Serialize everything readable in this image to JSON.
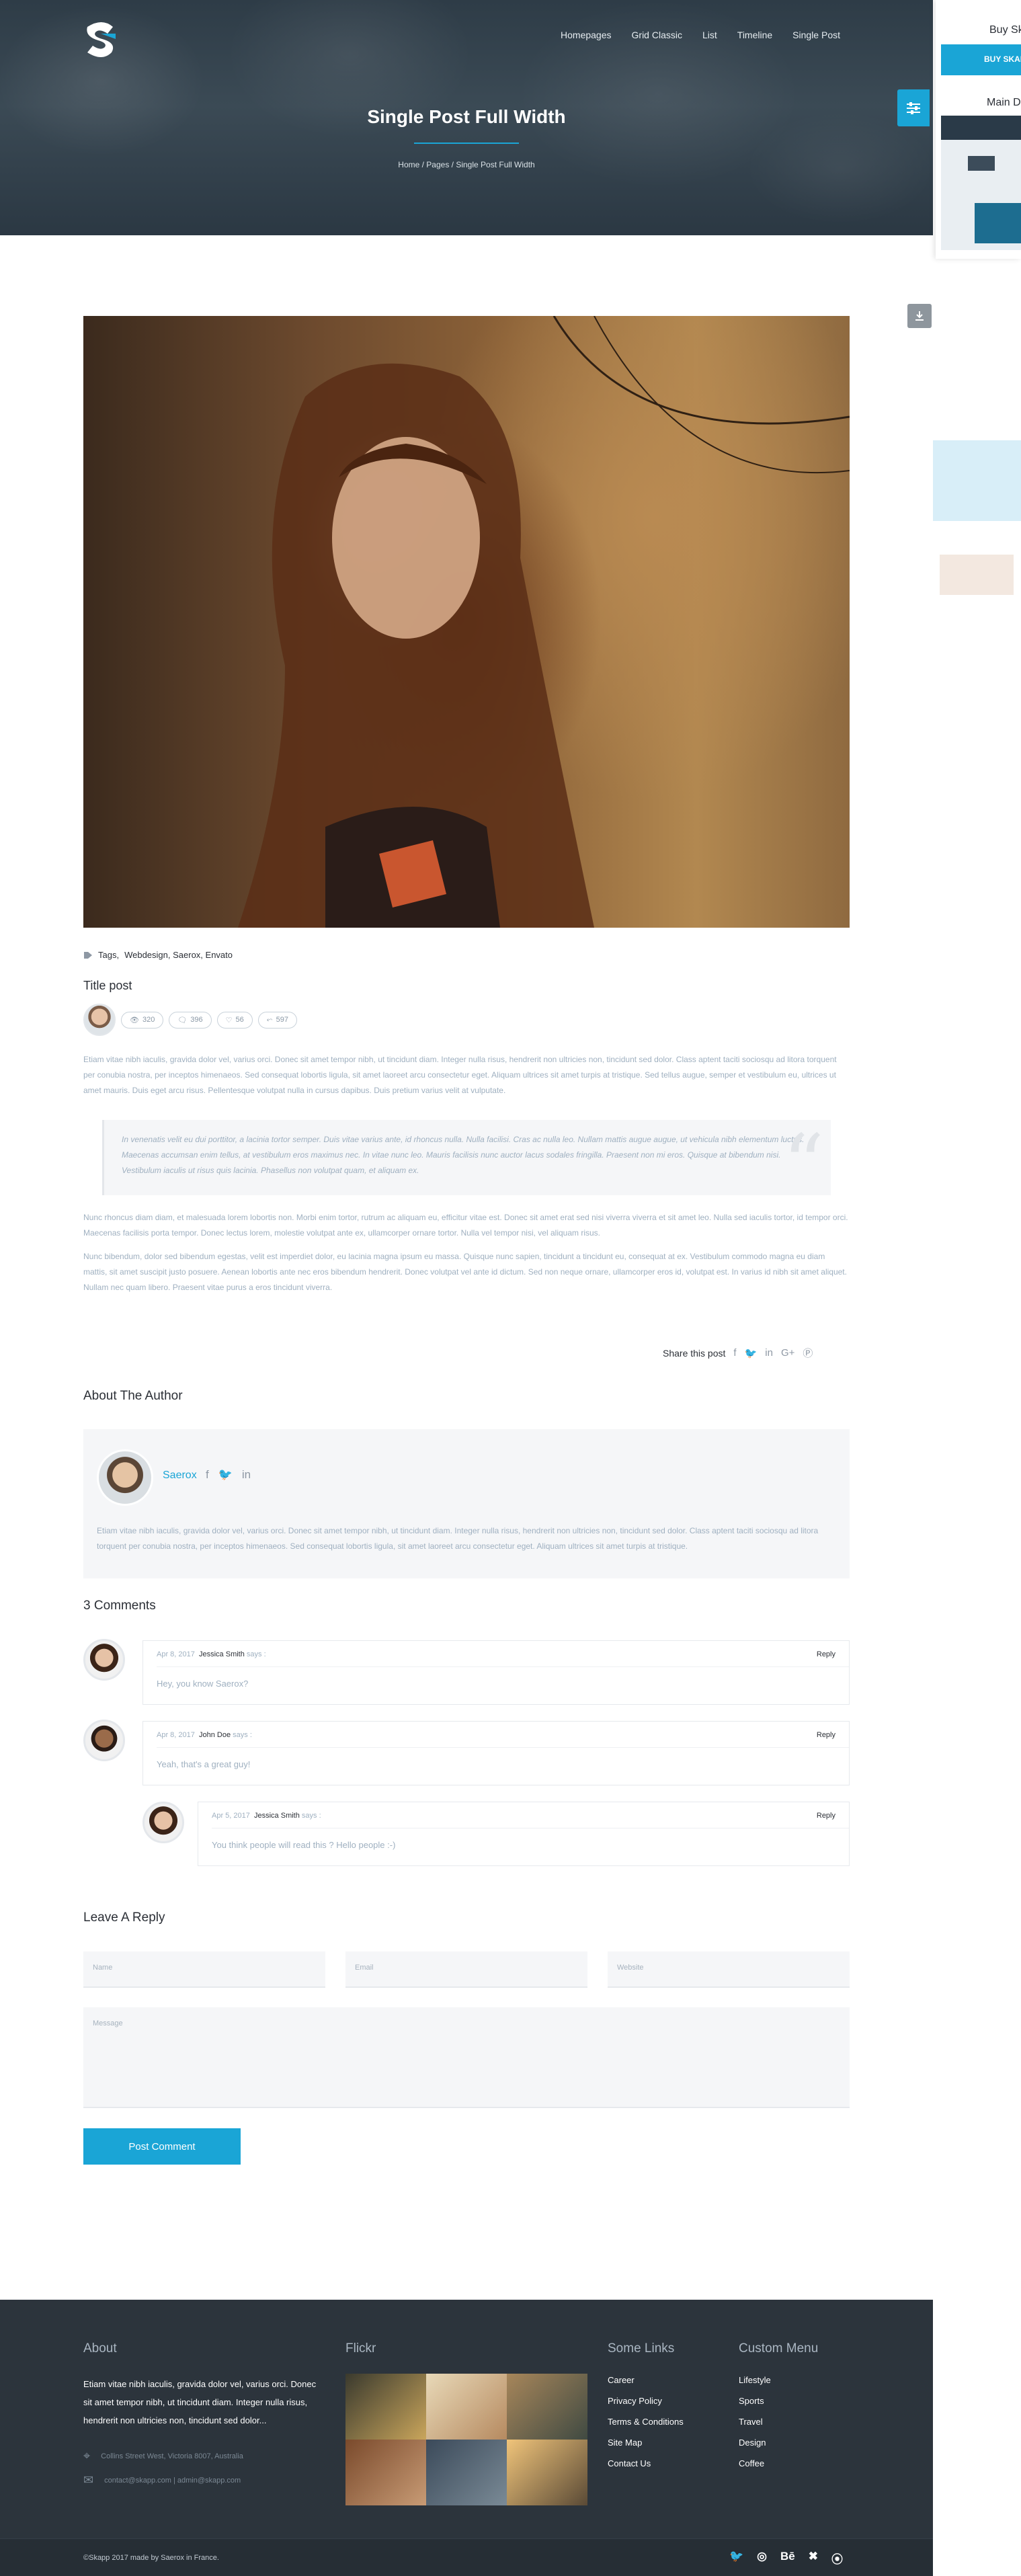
{
  "header": {
    "nav": [
      "Homepages",
      "Grid Classic",
      "List",
      "Timeline",
      "Single Post"
    ],
    "title": "Single Post Full Width",
    "breadcrumb": "Home  /  Pages  /  Single Post Full Width"
  },
  "side_panel": {
    "buy_title": "Buy Sk",
    "buy_button": "BUY SKAP",
    "main_demo": "Main D"
  },
  "post": {
    "tags_label": "Tags,",
    "tags": "Webdesign,  Saerox,  Envato",
    "title": "Title post",
    "stats": {
      "views": "320",
      "comments": "396",
      "likes": "56",
      "shares": "597"
    },
    "p1": "Etiam vitae nibh iaculis, gravida dolor vel, varius orci. Donec sit amet tempor nibh, ut tincidunt diam. Integer nulla risus, hendrerit non ultricies non, tincidunt sed dolor. Class aptent taciti sociosqu ad litora torquent per conubia nostra, per inceptos himenaeos. Sed consequat lobortis ligula, sit amet laoreet arcu consectetur eget. Aliquam ultrices sit amet turpis at tristique. Sed tellus augue, semper et vestibulum eu, ultrices ut amet mauris. Duis eget arcu risus. Pellentesque volutpat nulla in cursus dapibus. Duis pretium varius velit at vulputate.",
    "quote": "In venenatis velit eu dui porttitor, a lacinia tortor semper. Duis vitae varius ante, id rhoncus nulla. Nulla facilisi. Cras ac nulla leo. Nullam mattis augue augue, ut vehicula nibh elementum luctus. Maecenas accumsan enim tellus, at vestibulum eros maximus nec. In vitae nunc leo. Mauris facilisis nunc auctor lacus sodales fringilla. Praesent non mi eros. Quisque at bibendum nisi. Vestibulum iaculis ut risus quis lacinia. Phasellus non volutpat quam, et aliquam ex.",
    "p2": "Nunc rhoncus diam diam, et malesuada lorem lobortis non. Morbi enim tortor, rutrum ac aliquam eu, efficitur vitae est. Donec sit amet erat sed nisi viverra viverra et sit amet leo. Nulla sed iaculis tortor, id tempor orci. Maecenas facilisis porta tempor. Donec lectus lorem, molestie volutpat ante ex, ullamcorper ornare tortor. Nulla vel tempor nisi, vel aliquam risus.",
    "p3": "Nunc bibendum, dolor sed bibendum egestas, velit est imperdiet dolor, eu lacinia magna ipsum eu massa. Quisque nunc sapien, tincidunt a tincidunt eu, consequat at ex. Vestibulum commodo magna eu diam mattis, sit amet suscipit justo posuere. Aenean lobortis ante nec eros bibendum hendrerit. Donec volutpat vel ante id dictum. Sed non neque ornare, ullamcorper eros id, volutpat est. In varius id nibh sit amet aliquet. Nullam nec quam libero. Praesent vitae purus a eros tincidunt viverra.",
    "share_label": "Share this post"
  },
  "author": {
    "heading": "About The Author",
    "name": "Saerox",
    "bio": "Etiam vitae nibh iaculis, gravida dolor vel, varius orci. Donec sit amet tempor nibh, ut tincidunt diam. Integer nulla risus, hendrerit non ultricies non, tincidunt sed dolor. Class aptent taciti sociosqu ad litora torquent per conubia nostra, per inceptos himenaeos. Sed consequat lobortis ligula, sit amet laoreet arcu consectetur eget. Aliquam ultrices sit amet turpis at tristique."
  },
  "comments": {
    "heading": "3 Comments",
    "reply_label": "Reply",
    "says": "says :",
    "items": [
      {
        "date": "Apr 8, 2017",
        "name": "Jessica Smith",
        "text": "Hey, you know Saerox?"
      },
      {
        "date": "Apr 8, 2017",
        "name": "John Doe",
        "text": "Yeah, that's a great guy!"
      },
      {
        "date": "Apr 5, 2017",
        "name": "Jessica Smith",
        "text": "You think people will read this ? Hello people :-)"
      }
    ]
  },
  "reply_form": {
    "heading": "Leave A Reply",
    "name_placeholder": "Name",
    "email_placeholder": "Email",
    "website_placeholder": "Website",
    "message_placeholder": "Message",
    "submit": "Post Comment"
  },
  "footer": {
    "about_title": "About",
    "about_text": "Etiam vitae nibh iaculis, gravida dolor vel, varius orci. Donec sit amet tempor nibh, ut tincidunt diam. Integer nulla risus, hendrerit non ultricies non, tincidunt sed dolor...",
    "address": "Collins Street West, Victoria 8007, Australia",
    "email": "contact@skapp.com  |  admin@skapp.com",
    "flickr_title": "Flickr",
    "links_title": "Some Links",
    "links": [
      "Career",
      "Privacy Policy",
      "Terms & Conditions",
      "Site Map",
      "Contact Us"
    ],
    "menu_title": "Custom Menu",
    "menu": [
      "Lifestyle",
      "Sports",
      "Travel",
      "Design",
      "Coffee"
    ],
    "copyright": "©Skapp 2017 made by Saerox in France."
  },
  "colors": {
    "accent": "#1aa5d6",
    "footer_bg": "#2c343c",
    "text_muted": "#9fb0c0"
  }
}
